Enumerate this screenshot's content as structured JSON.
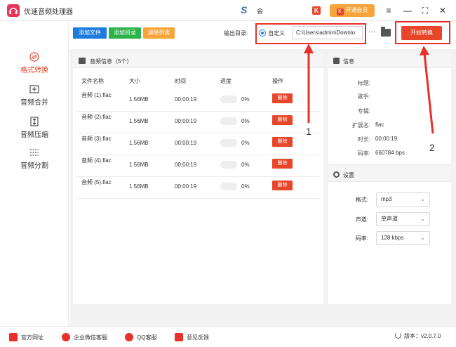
{
  "app": {
    "title": "优速音频处理器"
  },
  "header": {
    "s_text": "会",
    "vip_label": "开通会员"
  },
  "window_controls": {
    "menu": "≡",
    "minimize": "—",
    "maximize": "⛶",
    "close": "✕"
  },
  "sidebar": {
    "items": [
      {
        "label": "格式转换",
        "icon": "convert-icon",
        "active": true
      },
      {
        "label": "音频合并",
        "icon": "merge-icon"
      },
      {
        "label": "音频压缩",
        "icon": "compress-icon"
      },
      {
        "label": "音频分割",
        "icon": "split-icon"
      }
    ]
  },
  "toolbar": {
    "add_file": "添加文件",
    "add_folder": "添加目录",
    "clear_list": "清除列表",
    "output_label": "输出目录:",
    "custom_label": "自定义",
    "output_path": "C:\\Users\\admin\\Downlo",
    "more": "···",
    "start": "开始转换"
  },
  "file_panel": {
    "title": "音频信息（5个）",
    "columns": [
      "文件名称",
      "大小",
      "时间",
      "进度",
      "操作"
    ],
    "rows": [
      {
        "name": "音频 (1).flac",
        "size": "1.56MB",
        "time": "00:00:19",
        "progress": "0%",
        "action": "删除"
      },
      {
        "name": "音频 (2).flac",
        "size": "1.56MB",
        "time": "00:00:19",
        "progress": "0%",
        "action": "删除"
      },
      {
        "name": "音频 (3).flac",
        "size": "1.56MB",
        "time": "00:00:19",
        "progress": "0%",
        "action": "删除"
      },
      {
        "name": "音频 (4).flac",
        "size": "1.56MB",
        "time": "00:00:19",
        "progress": "0%",
        "action": "删除"
      },
      {
        "name": "音频 (5).flac",
        "size": "1.56MB",
        "time": "00:00:19",
        "progress": "0%",
        "action": "删除"
      }
    ]
  },
  "info_panel": {
    "title": "信息",
    "fields": [
      {
        "label": "标题:",
        "value": ""
      },
      {
        "label": "歌手:",
        "value": ""
      },
      {
        "label": "专辑:",
        "value": ""
      },
      {
        "label": "扩展名:",
        "value": "flac"
      },
      {
        "label": "时长:",
        "value": "00:00:19"
      },
      {
        "label": "码率:",
        "value": "660784 bps"
      }
    ]
  },
  "settings_panel": {
    "title": "设置",
    "format_label": "格式:",
    "format_value": "mp3",
    "channel_label": "声道:",
    "channel_value": "单声道",
    "bitrate_label": "码率:",
    "bitrate_value": "128 kbps"
  },
  "bottom": {
    "website": "官方网址",
    "wechat": "企业微信客服",
    "qq": "QQ客服",
    "feedback": "意见反馈",
    "version": "版本：v2.0.7.0"
  },
  "annotations": {
    "one": "1",
    "two": "2"
  },
  "colors": {
    "accent": "#e8462b",
    "blue": "#1e7ce0",
    "green": "#2db24a",
    "orange": "#f7a53b"
  }
}
